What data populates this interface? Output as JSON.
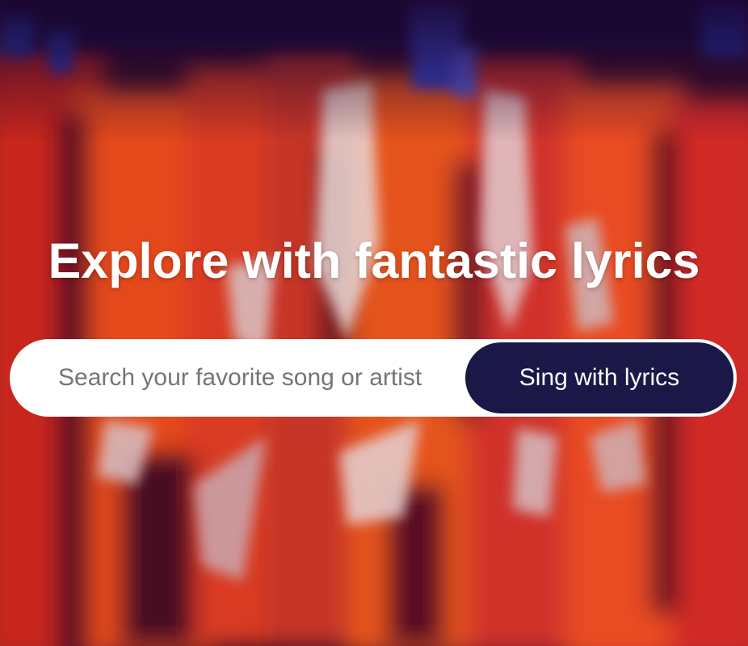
{
  "hero": {
    "headline": "Explore with fantastic lyrics",
    "background_image": "blurred-concert-dancers-photo"
  },
  "search": {
    "placeholder": "Search your favorite song or artist",
    "value": "",
    "button_label": "Sing with lyrics"
  },
  "colors": {
    "headline_text": "#ffffff",
    "search_bg": "#ffffff",
    "button_bg": "#1b1747",
    "button_text": "#ffffff",
    "placeholder_text": "#757575",
    "bg_orange": "#e8471e",
    "bg_red": "#d42a2a",
    "bg_dark": "#2a0a2e"
  }
}
